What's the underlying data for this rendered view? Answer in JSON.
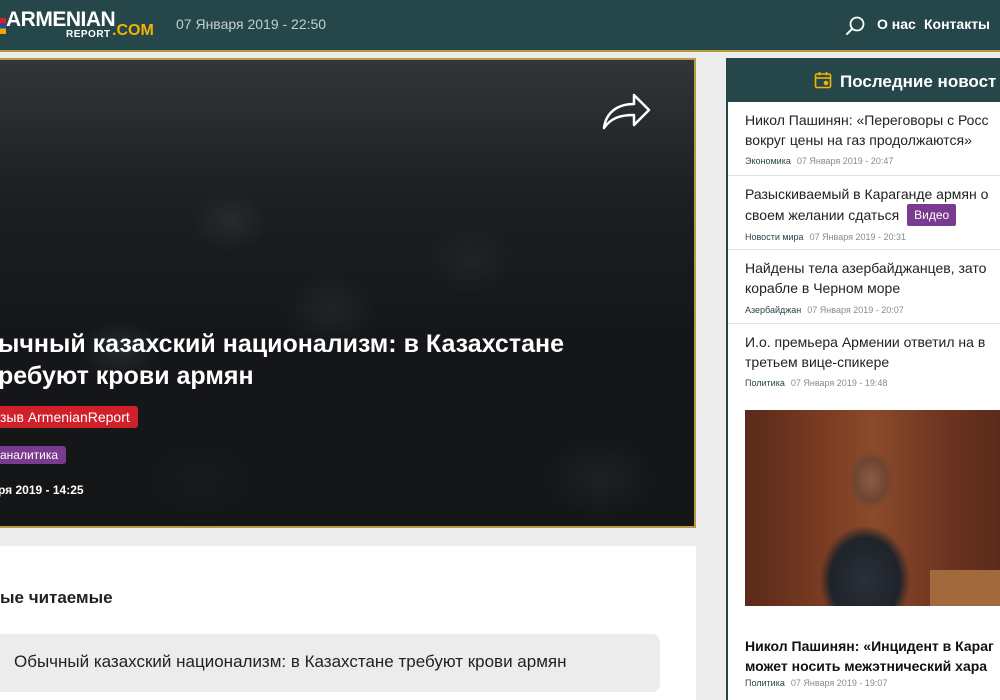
{
  "header": {
    "logo_main": "ARMENIAN",
    "logo_report": "REPORT",
    "logo_com": ".COM",
    "date": "07 Января 2019 - 22:50",
    "nav": [
      "О нас",
      "Контакты"
    ],
    "search_icon": "search-icon"
  },
  "hero": {
    "title": "ычный казахский национализм: в Казахстане ребуют крови армян",
    "badge_red": "зыв ArmenianReport",
    "badge_purple": "аналитика",
    "date": "ря 2019 - 14:25",
    "share_icon": "share-arrow-icon"
  },
  "mostread": {
    "title": "ые читаемые",
    "items": [
      "Обычный казахский национализм: в Казахстане требуют крови армян"
    ]
  },
  "latest": {
    "title": "Последние новост",
    "icon": "calendar-icon",
    "items": [
      {
        "text": "Никол Пашинян: «Переговоры с Росс вокруг цены на газ продолжаются»",
        "category": "Экономика",
        "time": "07 Января 2019 - 20:47"
      },
      {
        "text": "Разыскиваемый в Караганде армян о своем желании сдаться",
        "badge": "Видео",
        "category": "Новости мира",
        "time": "07 Января 2019 - 20:31"
      },
      {
        "text": "Найдены тела азербайджанцев, зато корабле в Черном море",
        "category": "Азербайджан",
        "time": "07 Января 2019 - 20:07"
      },
      {
        "text": "И.о. премьера Армении ответил на в третьем вице-спикере",
        "category": "Политика",
        "time": "07 Января 2019 - 19:48"
      }
    ],
    "featured": {
      "caption": "Никол Пашинян: «Инцидент в Караг может носить межэтнический хара",
      "category": "Политика",
      "time": "07 Января 2019 - 19:07"
    }
  }
}
